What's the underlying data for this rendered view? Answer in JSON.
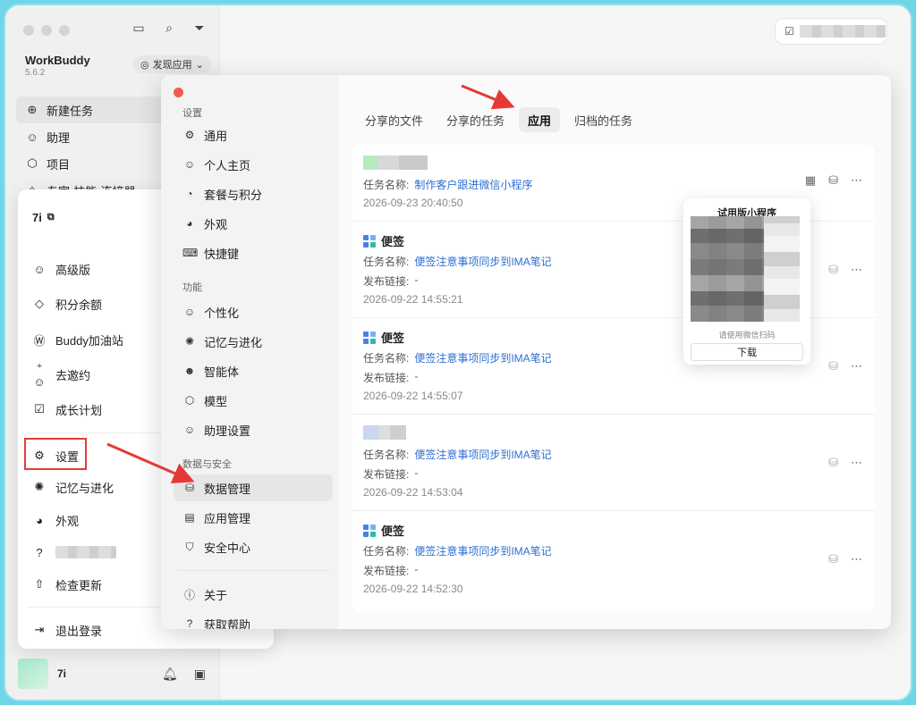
{
  "app": {
    "name": "WorkBuddy",
    "version": "5.6.2",
    "discover": "发现应用"
  },
  "sidebar": {
    "items": [
      {
        "label": "新建任务",
        "icon": "plus-circle-icon"
      },
      {
        "label": "助理",
        "icon": "assistant-icon"
      },
      {
        "label": "项目",
        "icon": "project-icon"
      },
      {
        "label": "专家·技能·连接器",
        "icon": "expert-icon"
      }
    ]
  },
  "user": {
    "name": "7i"
  },
  "popup": {
    "name": "7i",
    "items": [
      {
        "label": "高级版"
      },
      {
        "label": "积分余额"
      },
      {
        "label": "Buddy加油站"
      },
      {
        "label": "去邀约"
      },
      {
        "label": "成长计划"
      },
      {
        "label": "设置"
      },
      {
        "label": "记忆与进化"
      },
      {
        "label": "外观"
      },
      {
        "label": "检查更新"
      },
      {
        "label": "退出登录"
      }
    ]
  },
  "settings": {
    "sections": {
      "settings": "设置",
      "features": "功能",
      "data_security": "数据与安全"
    },
    "nav": [
      {
        "label": "通用"
      },
      {
        "label": "个人主页"
      },
      {
        "label": "套餐与积分"
      },
      {
        "label": "外观"
      },
      {
        "label": "快捷键"
      },
      {
        "label": "个性化"
      },
      {
        "label": "记忆与进化"
      },
      {
        "label": "智能体"
      },
      {
        "label": "模型"
      },
      {
        "label": "助理设置"
      },
      {
        "label": "数据管理"
      },
      {
        "label": "应用管理"
      },
      {
        "label": "安全中心"
      },
      {
        "label": "关于"
      },
      {
        "label": "获取帮助"
      }
    ],
    "tabs": [
      {
        "label": "分享的文件"
      },
      {
        "label": "分享的任务"
      },
      {
        "label": "应用"
      },
      {
        "label": "归档的任务"
      }
    ],
    "active_tab": "应用",
    "rows": [
      {
        "title": "",
        "task_label": "任务名称:",
        "task": "制作客户跟进微信小程序",
        "link_label": "",
        "link": "",
        "date": "2026-09-23 20:40:50"
      },
      {
        "title": "便签",
        "task_label": "任务名称:",
        "task": "便签注意事项同步到IMA笔记",
        "link_label": "发布链接:",
        "link": "-",
        "date": "2026-09-22 14:55:21"
      },
      {
        "title": "便签",
        "task_label": "任务名称:",
        "task": "便签注意事项同步到IMA笔记",
        "link_label": "发布链接:",
        "link": "-",
        "date": "2026-09-22 14:55:07"
      },
      {
        "title": "",
        "task_label": "任务名称:",
        "task": "便签注意事项同步到IMA笔记",
        "link_label": "发布链接:",
        "link": "-",
        "date": "2026-09-22 14:53:04"
      },
      {
        "title": "便签",
        "task_label": "任务名称:",
        "task": "便签注意事项同步到IMA笔记",
        "link_label": "发布链接:",
        "link": "-",
        "date": "2026-09-22 14:52:30"
      }
    ],
    "qr": {
      "title": "试用版小程序",
      "hint": "请使用微信扫码",
      "button": "下载"
    }
  },
  "colors": {
    "accent": "#2d6fd2",
    "annotation": "#e53935",
    "frame": "#8fe2ee"
  }
}
